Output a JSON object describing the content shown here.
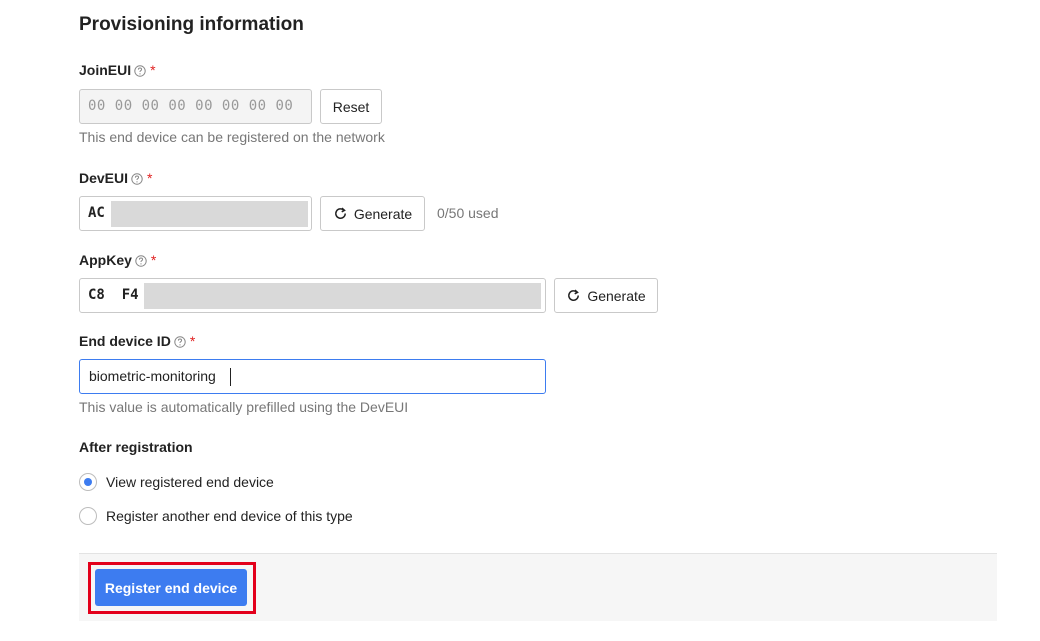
{
  "section_title": "Provisioning information",
  "join_eui": {
    "label": "JoinEUI",
    "required_mark": "*",
    "value": "00 00 00 00 00 00 00 00",
    "reset_label": "Reset",
    "description": "This end device can be registered on the network"
  },
  "dev_eui": {
    "label": "DevEUI",
    "required_mark": "*",
    "value_prefix": "AC",
    "generate_label": "Generate",
    "usage": "0/50 used"
  },
  "app_key": {
    "label": "AppKey",
    "required_mark": "*",
    "value_prefix": "C8  F4",
    "generate_label": "Generate"
  },
  "end_device_id": {
    "label": "End device ID",
    "required_mark": "*",
    "value": "biometric-monitoring",
    "description": "This value is automatically prefilled using the DevEUI"
  },
  "after_registration": {
    "title": "After registration",
    "options": [
      {
        "label": "View registered end device",
        "checked": true
      },
      {
        "label": "Register another end device of this type",
        "checked": false
      }
    ]
  },
  "footer": {
    "register_label": "Register end device"
  },
  "colors": {
    "accent": "#3d7cf0",
    "required": "#e02020",
    "highlight": "#e3001b"
  },
  "icons": {
    "help": "question-circle-icon",
    "generate": "refresh-icon"
  }
}
